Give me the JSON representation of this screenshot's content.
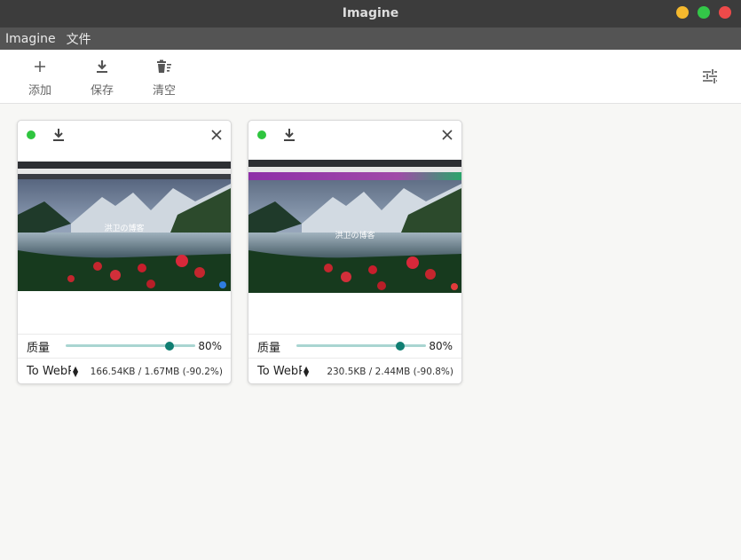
{
  "window": {
    "title": "Imagine"
  },
  "menu": {
    "items": [
      "Imagine",
      "文件"
    ]
  },
  "toolbar": {
    "add_label": "添加",
    "save_label": "保存",
    "clear_label": "清空"
  },
  "colors": {
    "accent": "#107e72",
    "track": "#a9d5d1",
    "status_ok": "#2fc53f"
  },
  "cards": [
    {
      "status": "ok",
      "thumb_caption": "洪卫の博客",
      "quality_label": "质量",
      "quality": 80,
      "quality_text": "80%",
      "format": "To WebP",
      "size_info": "166.54KB / 1.67MB (-90.2%)"
    },
    {
      "status": "ok",
      "thumb_caption": "洪卫の博客",
      "quality_label": "质量",
      "quality": 80,
      "quality_text": "80%",
      "format": "To WebP",
      "size_info": "230.5KB / 2.44MB (-90.8%)"
    }
  ]
}
